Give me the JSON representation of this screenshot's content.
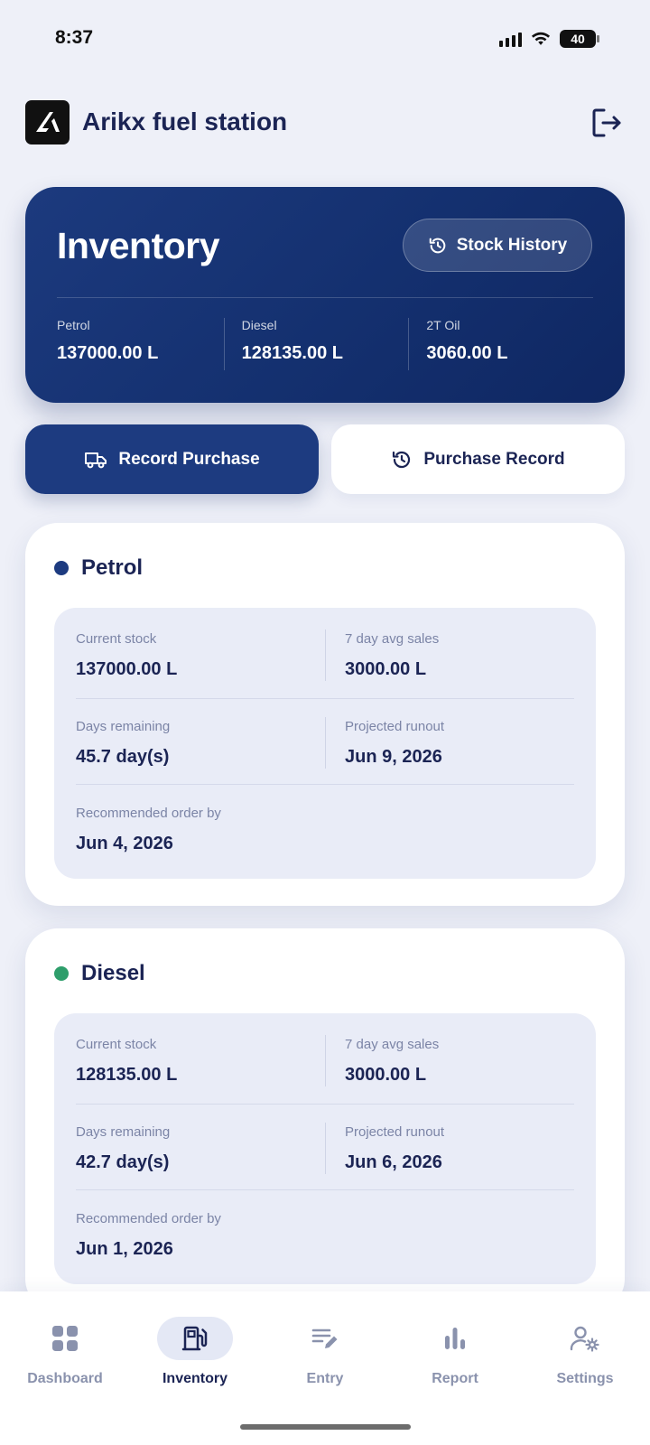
{
  "status_bar": {
    "time": "8:37",
    "battery": "40"
  },
  "header": {
    "title": "Arikx fuel station",
    "logout_icon": "logout-icon"
  },
  "hero": {
    "title": "Inventory",
    "stock_history_label": "Stock History",
    "stats": [
      {
        "label": "Petrol",
        "value": "137000.00 L"
      },
      {
        "label": "Diesel",
        "value": "128135.00 L"
      },
      {
        "label": "2T Oil",
        "value": "3060.00 L"
      }
    ]
  },
  "actions": {
    "record_purchase": "Record Purchase",
    "purchase_record": "Purchase Record"
  },
  "cards": [
    {
      "name": "Petrol",
      "dot_color": "#1d3b80",
      "current_stock_label": "Current stock",
      "current_stock": "137000.00 L",
      "avg_sales_label": "7 day avg sales",
      "avg_sales": "3000.00 L",
      "days_remaining_label": "Days remaining",
      "days_remaining": "45.7 day(s)",
      "runout_label": "Projected runout",
      "runout": "Jun 9, 2026",
      "order_by_label": "Recommended order by",
      "order_by": "Jun 4, 2026"
    },
    {
      "name": "Diesel",
      "dot_color": "#2e9e6b",
      "current_stock_label": "Current stock",
      "current_stock": "128135.00 L",
      "avg_sales_label": "7 day avg sales",
      "avg_sales": "3000.00 L",
      "days_remaining_label": "Days remaining",
      "days_remaining": "42.7 day(s)",
      "runout_label": "Projected runout",
      "runout": "Jun 6, 2026",
      "order_by_label": "Recommended order by",
      "order_by": "Jun 1, 2026"
    }
  ],
  "nav": {
    "active": "Inventory",
    "items": [
      {
        "label": "Dashboard",
        "icon": "dashboard-icon"
      },
      {
        "label": "Inventory",
        "icon": "fuel-pump-icon"
      },
      {
        "label": "Entry",
        "icon": "edit-list-icon"
      },
      {
        "label": "Report",
        "icon": "bar-chart-icon"
      },
      {
        "label": "Settings",
        "icon": "user-settings-icon"
      }
    ]
  },
  "colors": {
    "primary": "#1d3b80",
    "text": "#1b2454",
    "muted": "#7b84a6",
    "background": "#eef0f8",
    "diesel_accent": "#2e9e6b"
  }
}
